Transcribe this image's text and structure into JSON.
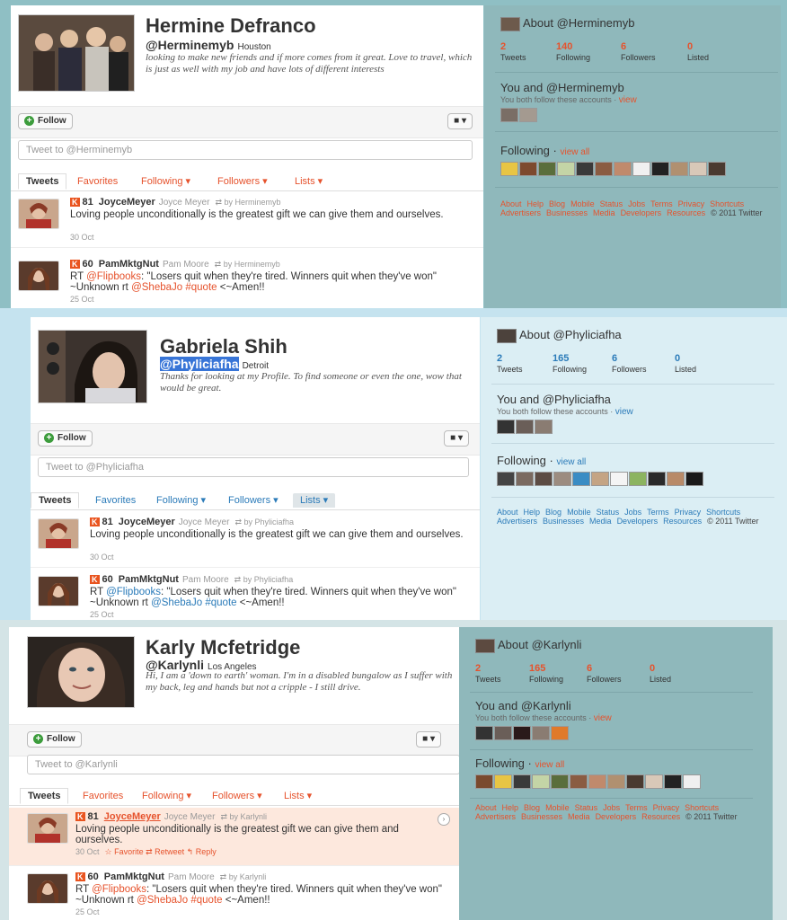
{
  "profiles": [
    {
      "name": "Hermine Defranco",
      "handle": "@Herminemyb",
      "location": "Houston",
      "bio": "looking to make new friends and if more comes from it great. Love to travel, which is just as well with my job and have lots of different interests",
      "follow_label": "Follow",
      "user_menu": "▾",
      "tweet_placeholder": "Tweet to @Herminemyb",
      "tabs": [
        "Tweets",
        "Favorites",
        "Following ▾",
        "Followers ▾",
        "Lists ▾"
      ],
      "tweets": [
        {
          "score": "81",
          "user": "JoyceMeyer",
          "realname": "Joyce Meyer",
          "rt": "by Herminemyb",
          "text_a": "Loving people unconditionally is the greatest gift we can give them and ourselves.",
          "date": "30 Oct"
        },
        {
          "score": "60",
          "user": "PamMktgNut",
          "realname": "Pam Moore",
          "rt": "by Herminemyb",
          "text_a": "RT ",
          "mention1": "@Flipbooks",
          "text_b": ": \"Losers quit when they're tired. Winners quit when they've won\" ~Unknown rt ",
          "mention2": "@ShebaJo",
          "mention3": "#quote",
          "text_c": " <~Amen!!",
          "date": "25 Oct"
        }
      ],
      "side": {
        "about": "About @Herminemyb",
        "stats": [
          {
            "n": "2",
            "l": "Tweets"
          },
          {
            "n": "140",
            "l": "Following"
          },
          {
            "n": "6",
            "l": "Followers"
          },
          {
            "n": "0",
            "l": "Listed"
          }
        ],
        "you_and": "You and @Herminemyb",
        "both_follow": "You both follow these accounts · ",
        "view": "view",
        "following": "Following",
        "view_all": "view all",
        "footer": [
          "About",
          "Help",
          "Blog",
          "Mobile",
          "Status",
          "Jobs",
          "Terms",
          "Privacy",
          "Shortcuts",
          "Advertisers",
          "Businesses",
          "Media",
          "Developers",
          "Resources"
        ],
        "copyright": "© 2011 Twitter"
      }
    },
    {
      "name": "Gabriela Shih",
      "handle": "@Phyliciafha",
      "location": "Detroit",
      "bio": "Thanks for looking at my Profile. To find someone or even the one, wow that would be great.",
      "follow_label": "Follow",
      "user_menu": "▾",
      "tweet_placeholder": "Tweet to @Phyliciafha",
      "tabs": [
        "Tweets",
        "Favorites",
        "Following ▾",
        "Followers ▾",
        "Lists ▾"
      ],
      "tweets": [
        {
          "score": "81",
          "user": "JoyceMeyer",
          "realname": "Joyce Meyer",
          "rt": "by Phyliciafha",
          "text_a": "Loving people unconditionally is the greatest gift we can give them and ourselves.",
          "date": "30 Oct"
        },
        {
          "score": "60",
          "user": "PamMktgNut",
          "realname": "Pam Moore",
          "rt": "by Phyliciafha",
          "text_a": "RT ",
          "mention1": "@Flipbooks",
          "text_b": ": \"Losers quit when they're tired. Winners quit when they've won\" ~Unknown rt ",
          "mention2": "@ShebaJo",
          "mention3": "#quote",
          "text_c": " <~Amen!!",
          "date": "25 Oct"
        }
      ],
      "side": {
        "about": "About @Phyliciafha",
        "stats": [
          {
            "n": "2",
            "l": "Tweets"
          },
          {
            "n": "165",
            "l": "Following"
          },
          {
            "n": "6",
            "l": "Followers"
          },
          {
            "n": "0",
            "l": "Listed"
          }
        ],
        "you_and": "You and @Phyliciafha",
        "both_follow": "You both follow these accounts · ",
        "view": "view",
        "following": "Following",
        "view_all": "view all",
        "footer": [
          "About",
          "Help",
          "Blog",
          "Mobile",
          "Status",
          "Jobs",
          "Terms",
          "Privacy",
          "Shortcuts",
          "Advertisers",
          "Businesses",
          "Media",
          "Developers",
          "Resources"
        ],
        "copyright": "© 2011 Twitter"
      }
    },
    {
      "name": "Karly Mcfetridge",
      "handle": "@Karlynli",
      "location": "Los Angeles",
      "bio": "Hi, I am a 'down to earth' woman. I'm in a disabled bungalow as I suffer with my back, leg and hands but not a cripple - I still drive.",
      "follow_label": "Follow",
      "user_menu": "▾",
      "tweet_placeholder": "Tweet to @Karlynli",
      "tabs": [
        "Tweets",
        "Favorites",
        "Following ▾",
        "Followers ▾",
        "Lists ▾"
      ],
      "tweets": [
        {
          "score": "81",
          "user": "JoyceMeyer",
          "realname": "Joyce Meyer",
          "rt": "by Karlynli",
          "text_a": "Loving people unconditionally is the greatest gift we can give them and ourselves.",
          "date": "30 Oct",
          "actions": "☆ Favorite   ⇄ Retweet   ↰ Reply"
        },
        {
          "score": "60",
          "user": "PamMktgNut",
          "realname": "Pam Moore",
          "rt": "by Karlynli",
          "text_a": "RT ",
          "mention1": "@Flipbooks",
          "text_b": ": \"Losers quit when they're tired. Winners quit when they've won\" ~Unknown rt ",
          "mention2": "@ShebaJo",
          "mention3": "#quote",
          "text_c": " <~Amen!!",
          "date": "25 Oct"
        }
      ],
      "side": {
        "about": "About @Karlynli",
        "stats": [
          {
            "n": "2",
            "l": "Tweets"
          },
          {
            "n": "165",
            "l": "Following"
          },
          {
            "n": "6",
            "l": "Followers"
          },
          {
            "n": "0",
            "l": "Listed"
          }
        ],
        "you_and": "You and @Karlynli",
        "both_follow": "You both follow these accounts · ",
        "view": "view",
        "following": "Following",
        "view_all": "view all",
        "footer": [
          "About",
          "Help",
          "Blog",
          "Mobile",
          "Status",
          "Jobs",
          "Terms",
          "Privacy",
          "Shortcuts",
          "Advertisers",
          "Businesses",
          "Media",
          "Developers",
          "Resources"
        ],
        "copyright": "© 2011 Twitter"
      }
    }
  ],
  "icons": {
    "retweet": "⇄",
    "plus": "+",
    "user": "👤",
    "caret": "›"
  },
  "colors": {
    "link_orange": "#e6522c",
    "link_blue": "#2b7bb9",
    "badge": "#e9541f"
  }
}
